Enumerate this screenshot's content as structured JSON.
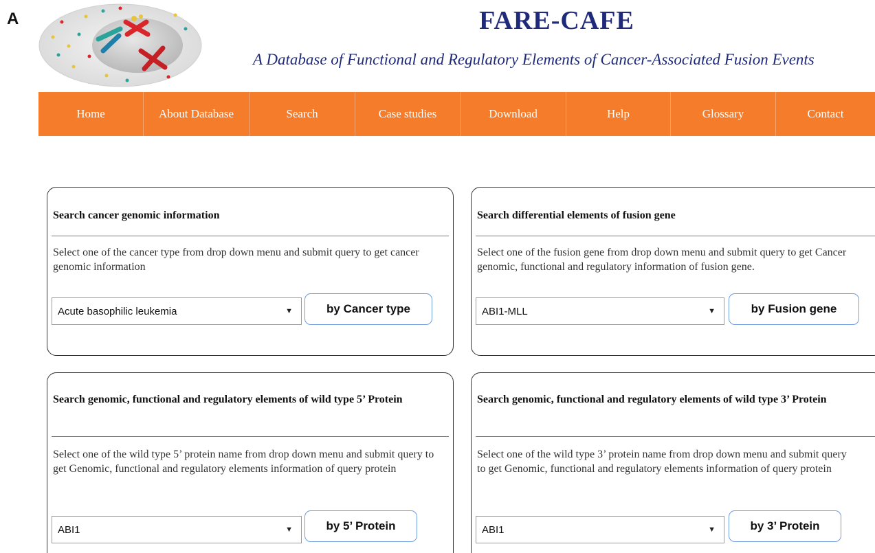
{
  "panel_label": "A",
  "header": {
    "title": "FARE-CAFE",
    "subtitle": "A Database of Functional and Regulatory Elements of Cancer-Associated Fusion Events"
  },
  "nav": {
    "items": [
      "Home",
      "About Database",
      "Search",
      "Case studies",
      "Download",
      "Help",
      "Glossary",
      "Contact"
    ]
  },
  "cards": {
    "cancer": {
      "title": "Search cancer genomic information",
      "description": "Select one of the cancer type from drop down menu and submit query to get cancer genomic information",
      "select_value": "Acute basophilic leukemia",
      "button": "by Cancer type"
    },
    "fusion": {
      "title": "Search differential elements of fusion gene",
      "description": "Select one of the fusion gene from drop down menu and submit query to get Cancer genomic, functional and regulatory information of fusion gene.",
      "select_value": "ABI1-MLL",
      "button": "by Fusion gene"
    },
    "protein5": {
      "title": "Search genomic, functional and regulatory elements of wild type 5’ Protein",
      "description": "Select one of the wild type 5’ protein name from drop down menu and submit query to get Genomic, functional and regulatory elements information of query protein",
      "select_value": "ABI1",
      "button": "by 5’ Protein"
    },
    "protein3": {
      "title": "Search genomic, functional and regulatory elements of wild type 3’ Protein",
      "description": "Select one of the wild type 3’ protein name from drop down menu and submit query to get Genomic, functional and regulatory elements information of query protein",
      "select_value": "ABI1",
      "button": "by 3’ Protein"
    }
  },
  "icons": {
    "dropdown_arrow": "▼"
  },
  "colors": {
    "nav_background": "#f47c2a",
    "title": "#1f2b7a",
    "button_border": "#6e9be0"
  }
}
